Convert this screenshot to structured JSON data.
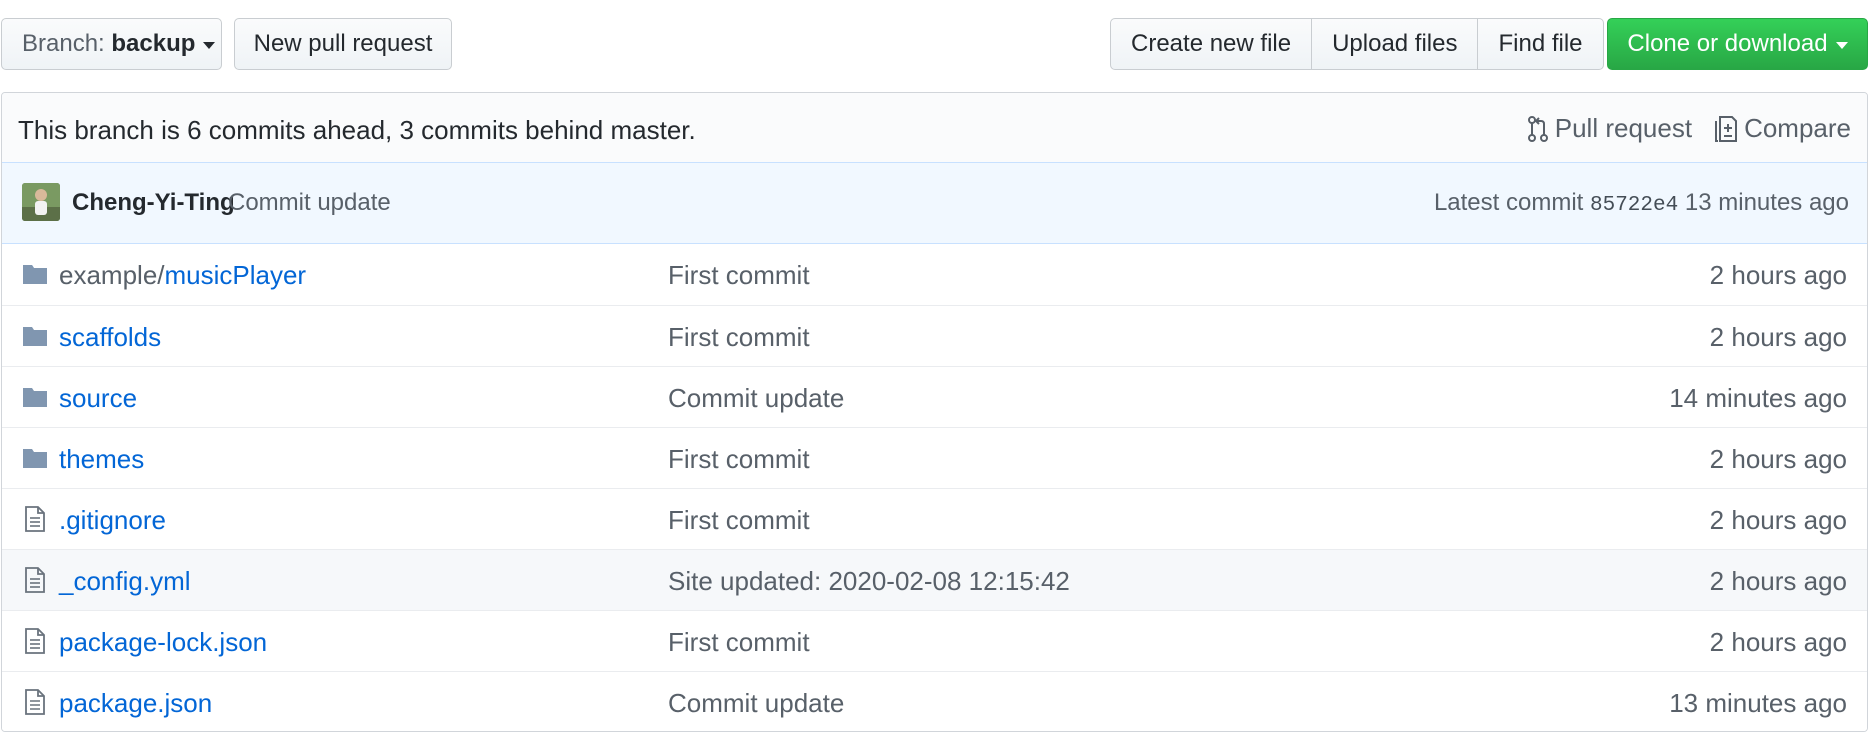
{
  "toolbar": {
    "branch_prefix": "Branch:",
    "branch_name": "backup",
    "new_pr_label": "New pull request",
    "create_file_label": "Create new file",
    "upload_files_label": "Upload files",
    "find_file_label": "Find file",
    "clone_label": "Clone or download"
  },
  "branch_info": {
    "status_text": "This branch is 6 commits ahead, 3 commits behind master.",
    "pull_request_label": "Pull request",
    "compare_label": "Compare"
  },
  "latest_commit": {
    "author": "Cheng-Yi-Ting",
    "message": "Commit update",
    "prefix": "Latest commit",
    "sha": "85722e4",
    "age": "13 minutes ago"
  },
  "files": [
    {
      "type": "folder",
      "prefix": "example/",
      "name": "musicPlayer",
      "message": "First commit",
      "age": "2 hours ago"
    },
    {
      "type": "folder",
      "prefix": "",
      "name": "scaffolds",
      "message": "First commit",
      "age": "2 hours ago"
    },
    {
      "type": "folder",
      "prefix": "",
      "name": "source",
      "message": "Commit update",
      "age": "14 minutes ago"
    },
    {
      "type": "folder",
      "prefix": "",
      "name": "themes",
      "message": "First commit",
      "age": "2 hours ago"
    },
    {
      "type": "file",
      "prefix": "",
      "name": ".gitignore",
      "message": "First commit",
      "age": "2 hours ago"
    },
    {
      "type": "file",
      "prefix": "",
      "name": "_config.yml",
      "message": "Site updated: 2020-02-08 12:15:42",
      "age": "2 hours ago"
    },
    {
      "type": "file",
      "prefix": "",
      "name": "package-lock.json",
      "message": "First commit",
      "age": "2 hours ago"
    },
    {
      "type": "file",
      "prefix": "",
      "name": "package.json",
      "message": "Commit update",
      "age": "13 minutes ago"
    }
  ],
  "colors": {
    "link": "#0366d6",
    "muted": "#586069",
    "green": "#28a745",
    "folder_icon": "#79b8ff"
  }
}
